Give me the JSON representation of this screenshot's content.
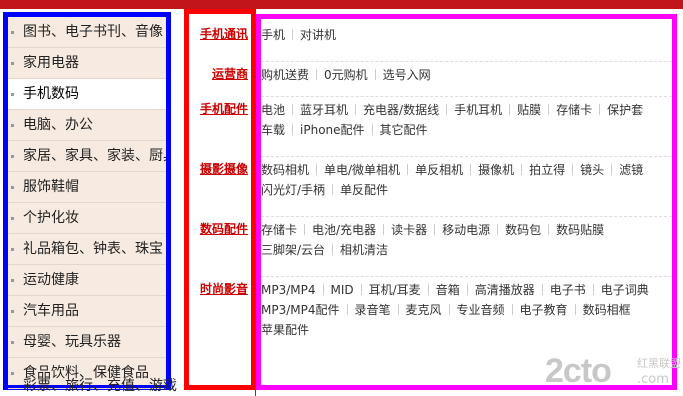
{
  "left_nav": {
    "items": [
      {
        "label": "图书、电子书刊、音像",
        "active": false
      },
      {
        "label": "家用电器",
        "active": false
      },
      {
        "label": "手机数码",
        "active": true
      },
      {
        "label": "电脑、办公",
        "active": false
      },
      {
        "label": "家居、家具、家装、厨具",
        "active": false
      },
      {
        "label": "服饰鞋帽",
        "active": false
      },
      {
        "label": "个护化妆",
        "active": false
      },
      {
        "label": "礼品箱包、钟表、珠宝",
        "active": false
      },
      {
        "label": "运动健康",
        "active": false
      },
      {
        "label": "汽车用品",
        "active": false
      },
      {
        "label": "母婴、玩具乐器",
        "active": false
      },
      {
        "label": "食品饮料、保健食品",
        "active": false
      }
    ],
    "more_label": "彩票、旅行、充值、游戏"
  },
  "categories": [
    {
      "title": "手机通讯",
      "lines": [
        [
          "手机",
          "对讲机"
        ]
      ]
    },
    {
      "title": "运营商",
      "lines": [
        [
          "购机送费",
          "0元购机",
          "选号入网"
        ]
      ]
    },
    {
      "title": "手机配件",
      "lines": [
        [
          "电池",
          "蓝牙耳机",
          "充电器/数据线",
          "手机耳机",
          "贴膜",
          "存储卡",
          "保护套"
        ],
        [
          "车载",
          "iPhone配件",
          "其它配件"
        ]
      ]
    },
    {
      "title": "摄影摄像",
      "lines": [
        [
          "数码相机",
          "单电/微单相机",
          "单反相机",
          "摄像机",
          "拍立得",
          "镜头",
          "滤镜"
        ],
        [
          "闪光灯/手柄",
          "单反配件"
        ]
      ]
    },
    {
      "title": "数码配件",
      "lines": [
        [
          "存储卡",
          "电池/充电器",
          "读卡器",
          "移动电源",
          "数码包",
          "数码贴膜"
        ],
        [
          "三脚架/云台",
          "相机清洁"
        ]
      ]
    },
    {
      "title": "时尚影音",
      "lines": [
        [
          "MP3/MP4",
          "MID",
          "耳机/耳麦",
          "音箱",
          "高清播放器",
          "电子书",
          "电子词典"
        ],
        [
          "MP3/MP4配件",
          "录音笔",
          "麦克风",
          "专业音频",
          "电子教育",
          "数码相框"
        ],
        [
          "苹果配件"
        ]
      ]
    }
  ],
  "watermark": {
    "main": "2cto",
    "sub": "红黑联盟",
    "domain": ".com"
  }
}
